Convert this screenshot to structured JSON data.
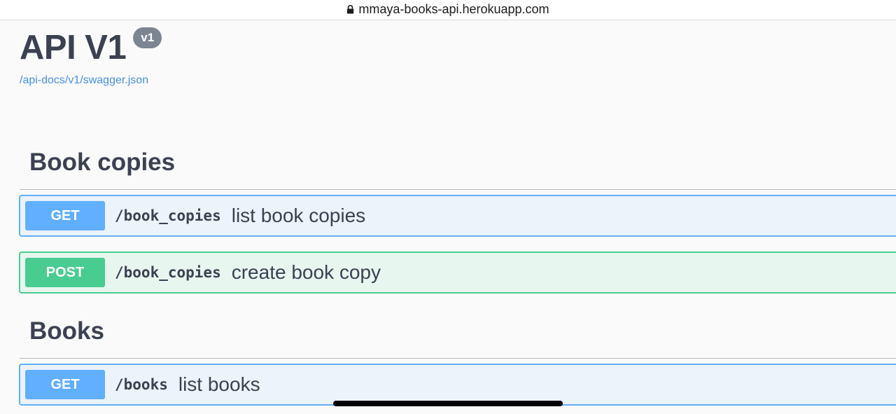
{
  "browser": {
    "url": "mmaya-books-api.herokuapp.com",
    "lock_icon": "lock-icon"
  },
  "info": {
    "title": "API V1",
    "version": "v1",
    "spec_url": "/api-docs/v1/swagger.json"
  },
  "colors": {
    "get": "#61affe",
    "post": "#49cc90",
    "link": "#4990e2",
    "text": "#3b4151"
  },
  "tags": [
    {
      "name": "Book copies",
      "operations": [
        {
          "method": "GET",
          "path": "/book_copies",
          "summary": "list book copies"
        },
        {
          "method": "POST",
          "path": "/book_copies",
          "summary": "create book copy"
        }
      ]
    },
    {
      "name": "Books",
      "operations": [
        {
          "method": "GET",
          "path": "/books",
          "summary": "list books"
        }
      ]
    }
  ]
}
